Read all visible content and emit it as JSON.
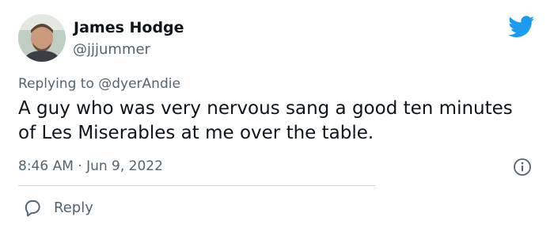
{
  "author": {
    "name": "James Hodge",
    "handle": "@jjjummer"
  },
  "replying": {
    "prefix": "Replying to",
    "mention": "@dyerAndie"
  },
  "tweet": {
    "text": "A guy who was very nervous sang a good ten minutes of Les Miserables at me over the table."
  },
  "meta": {
    "timestamp": "8:46 AM · Jun 9, 2022"
  },
  "actions": {
    "reply_label": "Reply"
  },
  "icons": {
    "brand": "twitter-bird-icon",
    "info": "info-icon",
    "reply": "reply-bubble-icon"
  },
  "colors": {
    "brand": "#1d9bf0",
    "text": "#0f1419",
    "secondary": "#536471",
    "divider": "#cfd9de"
  }
}
